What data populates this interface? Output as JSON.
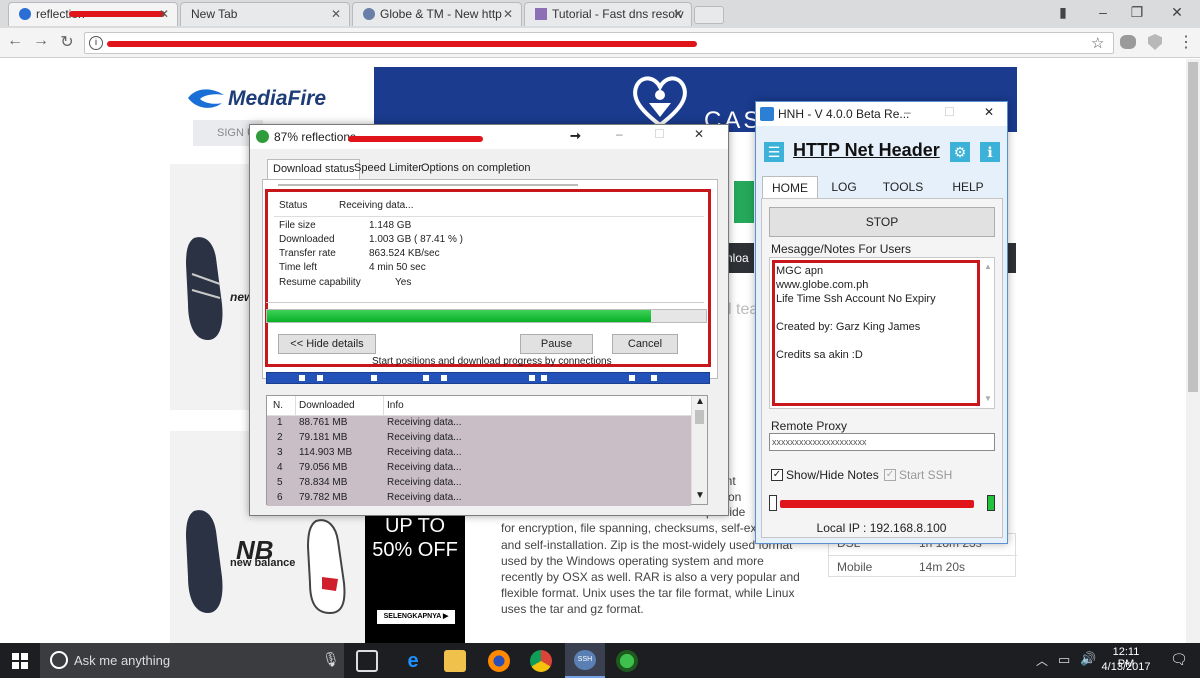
{
  "browser": {
    "tabs": [
      {
        "label": "reflection"
      },
      {
        "label": "New Tab"
      },
      {
        "label": "Globe & TM - New http"
      },
      {
        "label": "Tutorial - Fast dns resolv"
      }
    ]
  },
  "page": {
    "mediafire_logo": "MediaFire",
    "sign_in": "SIGN U",
    "casa": "CASA",
    "ad_brand_top": "new",
    "ad_brand": "new balance",
    "ad_promo_line1": "UP TO",
    "ad_promo_line2": "50% OFF",
    "ad_cta": "SELENGKAPNYA",
    "side_text_tea": "l tea",
    "side_text_nloa": "nloa",
    "article_fragments": [
      "es int",
      "ve on",
      "provide",
      "for encryption, file spanning, checksums, self-ex"
    ],
    "article_lines": [
      "and self-installation. Zip is the most-widely used format",
      "used by the Windows operating system and more",
      "recently by OSX as well. RAR is also a very popular and",
      "flexible format. Unix uses the tar file format, while Linux",
      "uses the tar and gz format."
    ],
    "speed_table": [
      {
        "label": "DSL",
        "value": "1h 18m 23s"
      },
      {
        "label": "Mobile",
        "value": "14m 20s"
      }
    ]
  },
  "download_manager": {
    "title_prefix": "87% reflections",
    "tabs": [
      "Download status",
      "Speed Limiter",
      "Options on completion"
    ],
    "status_label": "Status",
    "status_value": "Receiving data...",
    "fields": [
      {
        "label": "File size",
        "value": "1.148  GB"
      },
      {
        "label": "Downloaded",
        "value": "1.003  GB  ( 87.41 % )"
      },
      {
        "label": "Transfer rate",
        "value": "863.524  KB/sec"
      },
      {
        "label": "Time left",
        "value": "4 min 50 sec"
      },
      {
        "label": "Resume capability",
        "value": "Yes"
      }
    ],
    "progress": 0.8741,
    "hide_details_label": "<< Hide details",
    "pause_label": "Pause",
    "cancel_label": "Cancel",
    "connections_caption": "Start positions and download progress by connections",
    "table_headers": [
      "N.",
      "Downloaded",
      "Info"
    ],
    "connections": [
      {
        "n": "1",
        "downloaded": "88.761  MB",
        "info": "Receiving data..."
      },
      {
        "n": "2",
        "downloaded": "79.181  MB",
        "info": "Receiving data..."
      },
      {
        "n": "3",
        "downloaded": "114.903  MB",
        "info": "Receiving data..."
      },
      {
        "n": "4",
        "downloaded": "79.056  MB",
        "info": "Receiving data..."
      },
      {
        "n": "5",
        "downloaded": "78.834  MB",
        "info": "Receiving data..."
      },
      {
        "n": "6",
        "downloaded": "79.782  MB",
        "info": "Receiving data..."
      }
    ]
  },
  "hnh": {
    "window_title": "HNH - V 4.0.0 Beta Re...",
    "app_title": "HTTP Net Header",
    "tabs": [
      "HOME",
      "LOG",
      "TOOLS",
      "HELP"
    ],
    "stop_label": "STOP",
    "notes_label": "Mesagge/Notes For Users",
    "notes_lines": [
      "MGC apn",
      "www.globe.com.ph",
      "Life Time Ssh Account No Expiry",
      "",
      "Created by: Garz King James",
      "",
      "Credits sa akin :D"
    ],
    "remote_proxy_label": "Remote Proxy",
    "remote_proxy_value": "xxxxxxxxxxxxxxxxxxxxx",
    "show_hide_notes_label": "Show/Hide Notes",
    "start_ssh_label": "Start SSH",
    "local_ip": "Local IP : 192.168.8.100"
  },
  "taskbar": {
    "search_placeholder": "Ask me anything",
    "time": "12:11 PM",
    "date": "4/13/2017"
  },
  "colors": {
    "red_annotation": "#c8161d",
    "progress_green": "#06b025",
    "hnh_blue": "#2b7fd4",
    "taskbar": "#1c1e22"
  }
}
